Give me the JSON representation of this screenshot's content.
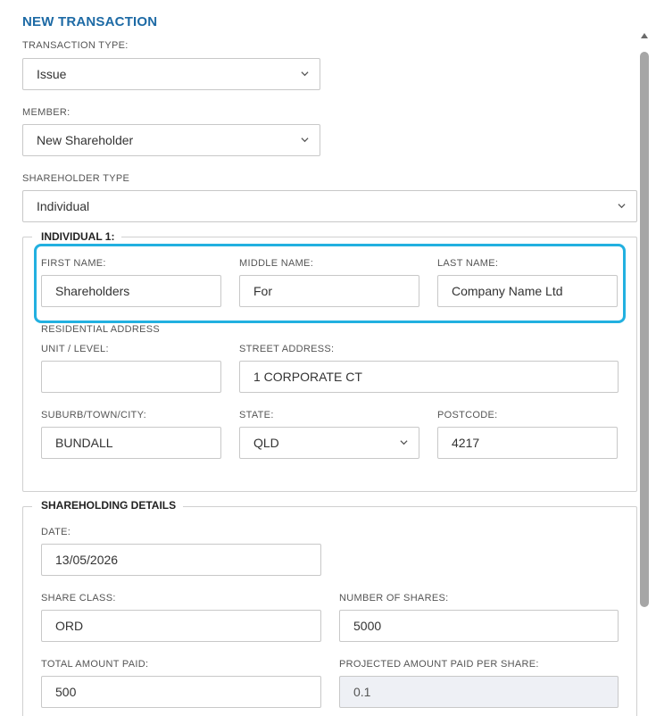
{
  "title": "NEW TRANSACTION",
  "transaction_type": {
    "label": "TRANSACTION TYPE:",
    "value": "Issue"
  },
  "member": {
    "label": "MEMBER:",
    "value": "New Shareholder"
  },
  "shareholder_type": {
    "label": "SHAREHOLDER TYPE",
    "value": "Individual"
  },
  "individual": {
    "legend": "INDIVIDUAL 1:",
    "first_name": {
      "label": "FIRST NAME:",
      "value": "Shareholders"
    },
    "middle_name": {
      "label": "MIDDLE NAME:",
      "value": "For"
    },
    "last_name": {
      "label": "LAST NAME:",
      "value": "Company Name Ltd"
    },
    "residential_address_label": "RESIDENTIAL ADDRESS",
    "unit_level": {
      "label": "UNIT / LEVEL:",
      "value": ""
    },
    "street_address": {
      "label": "STREET ADDRESS:",
      "value": "1 CORPORATE CT"
    },
    "suburb": {
      "label": "SUBURB/TOWN/CITY:",
      "value": "BUNDALL"
    },
    "state": {
      "label": "STATE:",
      "value": "QLD"
    },
    "postcode": {
      "label": "POSTCODE:",
      "value": "4217"
    }
  },
  "shareholding": {
    "legend": "SHAREHOLDING DETAILS",
    "date": {
      "label": "DATE:",
      "value": "13/05/2026"
    },
    "share_class": {
      "label": "SHARE CLASS:",
      "value": "ORD"
    },
    "number_of_shares": {
      "label": "NUMBER OF SHARES:",
      "value": "5000"
    },
    "total_amount_paid": {
      "label": "TOTAL AMOUNT PAID:",
      "value": "500"
    },
    "projected_amount_per_share": {
      "label": "PROJECTED AMOUNT PAID PER SHARE:",
      "value": "0.1"
    }
  },
  "icons": {
    "dropdown": "chevron-down-icon",
    "scroll_up": "scroll-up-arrow-icon"
  },
  "colors": {
    "title": "#1d6aa5",
    "highlight": "#22b0e0",
    "readonly_bg": "#eef0f5"
  }
}
